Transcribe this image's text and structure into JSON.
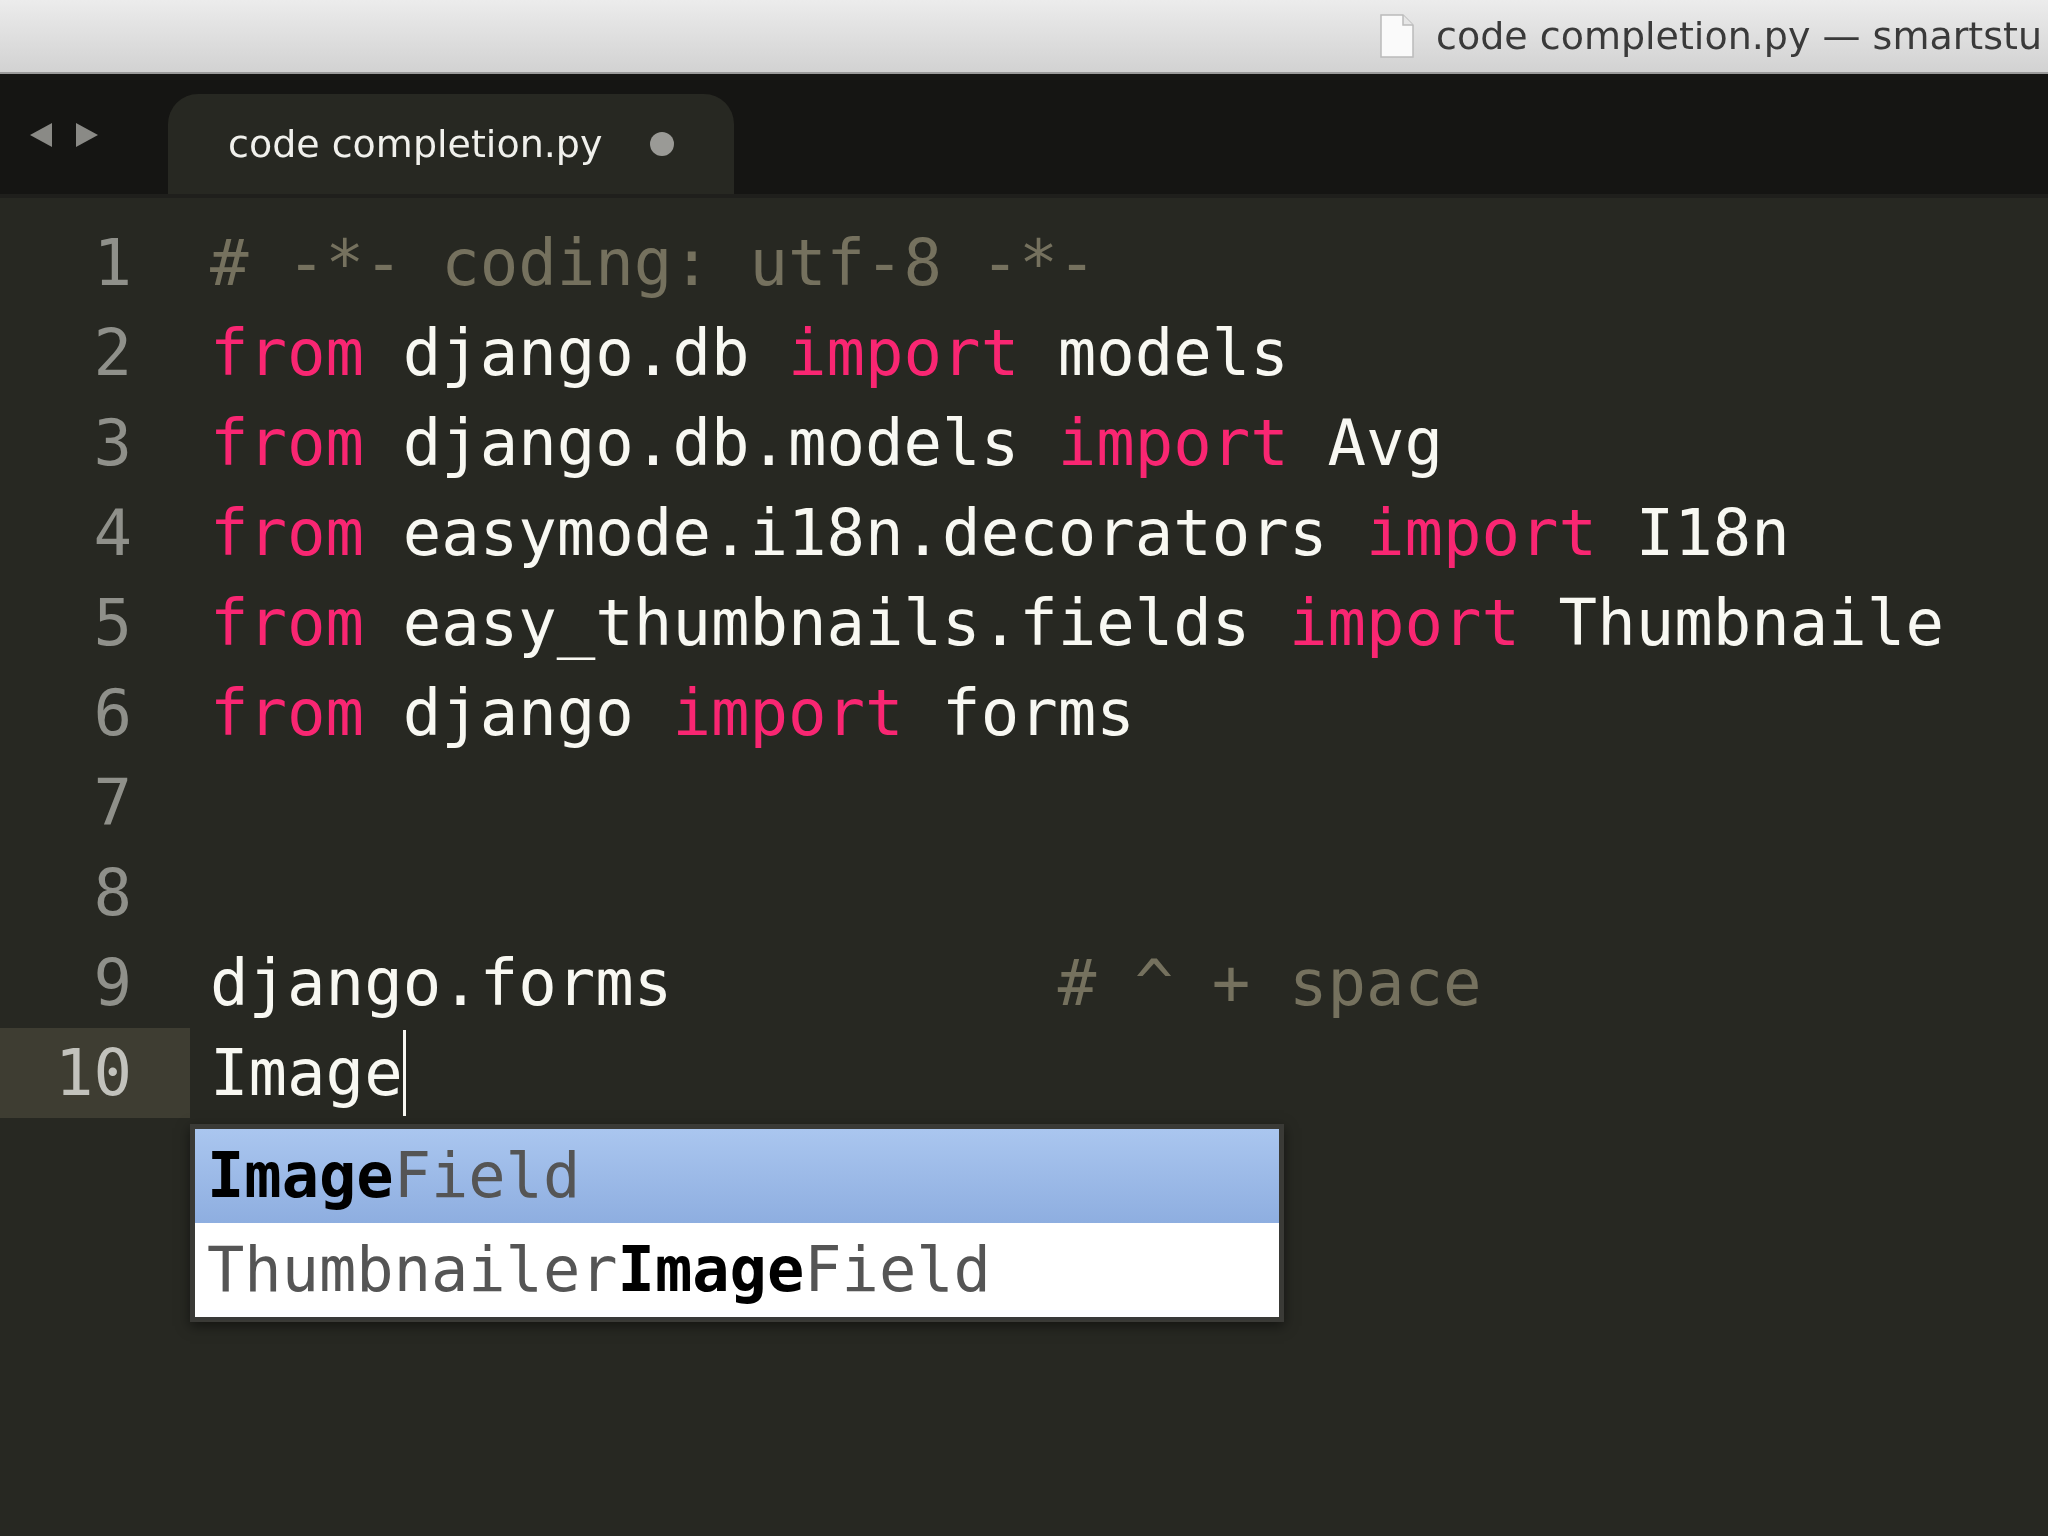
{
  "title_bar": {
    "title": "code completion.py — smartstu"
  },
  "tabs": [
    {
      "label": "code completion.py",
      "selected": true,
      "modified": true
    }
  ],
  "editor": {
    "lines": [
      {
        "number": "1",
        "current": false,
        "tokens": [
          {
            "kind": "comment",
            "text": "# -*- coding: utf-8 -*-"
          }
        ]
      },
      {
        "number": "2",
        "current": false,
        "tokens": [
          {
            "kind": "keyword",
            "text": "from"
          },
          {
            "kind": "plain",
            "text": " django.db "
          },
          {
            "kind": "keyword",
            "text": "import"
          },
          {
            "kind": "plain",
            "text": " models"
          }
        ]
      },
      {
        "number": "3",
        "current": false,
        "tokens": [
          {
            "kind": "keyword",
            "text": "from"
          },
          {
            "kind": "plain",
            "text": " django.db.models "
          },
          {
            "kind": "keyword",
            "text": "import"
          },
          {
            "kind": "plain",
            "text": " Avg"
          }
        ]
      },
      {
        "number": "4",
        "current": false,
        "tokens": [
          {
            "kind": "keyword",
            "text": "from"
          },
          {
            "kind": "plain",
            "text": " easymode.i18n.decorators "
          },
          {
            "kind": "keyword",
            "text": "import"
          },
          {
            "kind": "plain",
            "text": " I18n"
          }
        ]
      },
      {
        "number": "5",
        "current": false,
        "tokens": [
          {
            "kind": "keyword",
            "text": "from"
          },
          {
            "kind": "plain",
            "text": " easy_thumbnails.fields "
          },
          {
            "kind": "keyword",
            "text": "import"
          },
          {
            "kind": "plain",
            "text": " Thumbnaile"
          }
        ]
      },
      {
        "number": "6",
        "current": false,
        "tokens": [
          {
            "kind": "keyword",
            "text": "from"
          },
          {
            "kind": "plain",
            "text": " django "
          },
          {
            "kind": "keyword",
            "text": "import"
          },
          {
            "kind": "plain",
            "text": " forms"
          }
        ]
      },
      {
        "number": "7",
        "current": false
      },
      {
        "number": "8",
        "current": false
      },
      {
        "number": "9",
        "current": false,
        "tokens": [
          {
            "kind": "plain",
            "text": "django.forms          "
          },
          {
            "kind": "comment",
            "text": "# ^ + space"
          }
        ]
      },
      {
        "number": "10",
        "current": true,
        "tokens": [
          {
            "kind": "plain",
            "text": "Image"
          }
        ]
      }
    ]
  },
  "completion": {
    "items": [
      {
        "text": "**Image**Field",
        "selected": true
      },
      {
        "text": "Thumbnailer**Image**Field",
        "selected": false
      }
    ]
  }
}
